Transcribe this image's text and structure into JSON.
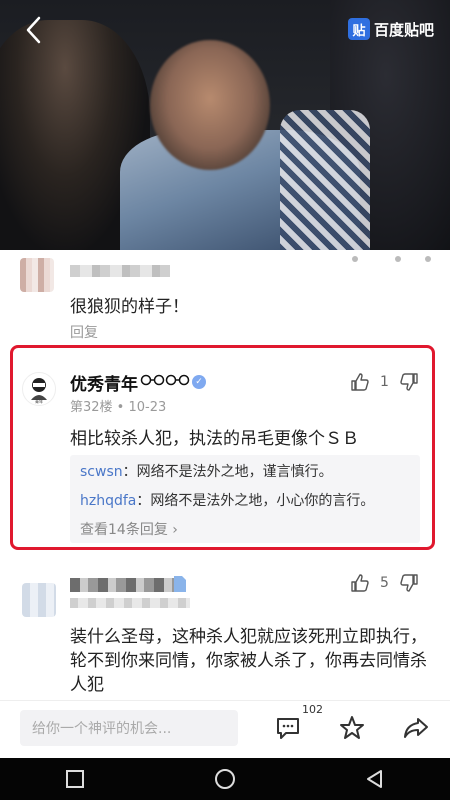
{
  "header": {
    "brand_text": "百度贴吧",
    "brand_mark": "贴"
  },
  "comment_1": {
    "text": "很狼狈的样子！",
    "reply_label": "回复"
  },
  "comment_2": {
    "user_name": "优秀青年",
    "floor_meta": "第32楼 • 10-23",
    "text": "相比较杀人犯，执法的吊毛更像个ＳＢ",
    "like_count": "1",
    "sub_replies": [
      {
        "user": "scwsn",
        "content": "：网络不是法外之地，谨言慎行。"
      },
      {
        "user": "hzhqdfa",
        "content": "：网络不是法外之地，小心你的言行。"
      }
    ],
    "view_more": "查看14条回复 ›"
  },
  "comment_3": {
    "text": "装什么圣母，这种杀人犯就应该死刑立即执行，轮不到你来同情，你家被人杀了，你再去同情杀人犯",
    "like_count": "5"
  },
  "input_bar": {
    "placeholder": "给你一个神评的机会...",
    "comment_count": "102"
  },
  "colors": {
    "highlight": "#e0182e",
    "link_user": "#4a77c8",
    "brand": "#2f6fe0"
  }
}
